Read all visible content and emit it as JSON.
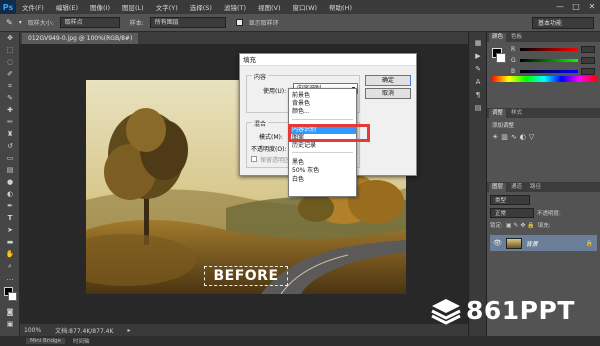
{
  "app": {
    "logo": "Ps"
  },
  "menu": [
    "文件(F)",
    "编辑(E)",
    "图像(I)",
    "图层(L)",
    "文字(Y)",
    "选择(S)",
    "滤镜(T)",
    "视图(V)",
    "窗口(W)",
    "帮助(H)"
  ],
  "window_controls": [
    "—",
    "□",
    "✕"
  ],
  "options_bar": {
    "size_label": "取样大小:",
    "size_value": "取样点",
    "sample_label": "样本:",
    "sample_value": "所有图层",
    "show_ring_label": "显示取样环"
  },
  "workspace": "基本功能",
  "document": {
    "tab_label": "012GV949-0.jpg @ 100%(RGB/8#)"
  },
  "photo": {
    "caption": "BEFORE"
  },
  "status": {
    "zoom": "100%",
    "doc_info": "文档:877.4K/877.4K"
  },
  "bottom_tabs": [
    "Mini Bridge",
    "时间轴"
  ],
  "panels": {
    "color_tabs": [
      "颜色",
      "色板"
    ],
    "color_sliders": [
      "R",
      "G",
      "B"
    ],
    "adjust_tabs": [
      "调整",
      "样式"
    ],
    "adjust_label": "添加调整",
    "layers_tabs": [
      "图层",
      "通道",
      "路径"
    ],
    "layers_filter": "类型",
    "blend_mode": "正常",
    "opacity_label": "不透明度:",
    "lock_label": "锁定:",
    "fill_label": "填充:",
    "layer_name": "背景"
  },
  "dialog": {
    "title": "填充",
    "content_group": "内容",
    "use_label": "使用(U):",
    "use_value": "内容识别",
    "blend_group": "混合",
    "mode_label": "模式(M):",
    "opacity_label": "不透明度(O):",
    "preserve_label": "保留透明区域",
    "ok": "确定",
    "cancel": "取消"
  },
  "dropdown": {
    "group1": [
      "前景色",
      "背景色",
      "颜色..."
    ],
    "group2": [
      "内容识别",
      "图案",
      "历史记录"
    ],
    "group3": [
      "黑色",
      "50% 灰色",
      "白色"
    ],
    "selected": "内容识别"
  },
  "watermark": {
    "text": "861PPT"
  },
  "colors": {
    "highlight": "#e23a3a",
    "selection": "#3399ff",
    "ps_blue": "#37a6f7"
  }
}
